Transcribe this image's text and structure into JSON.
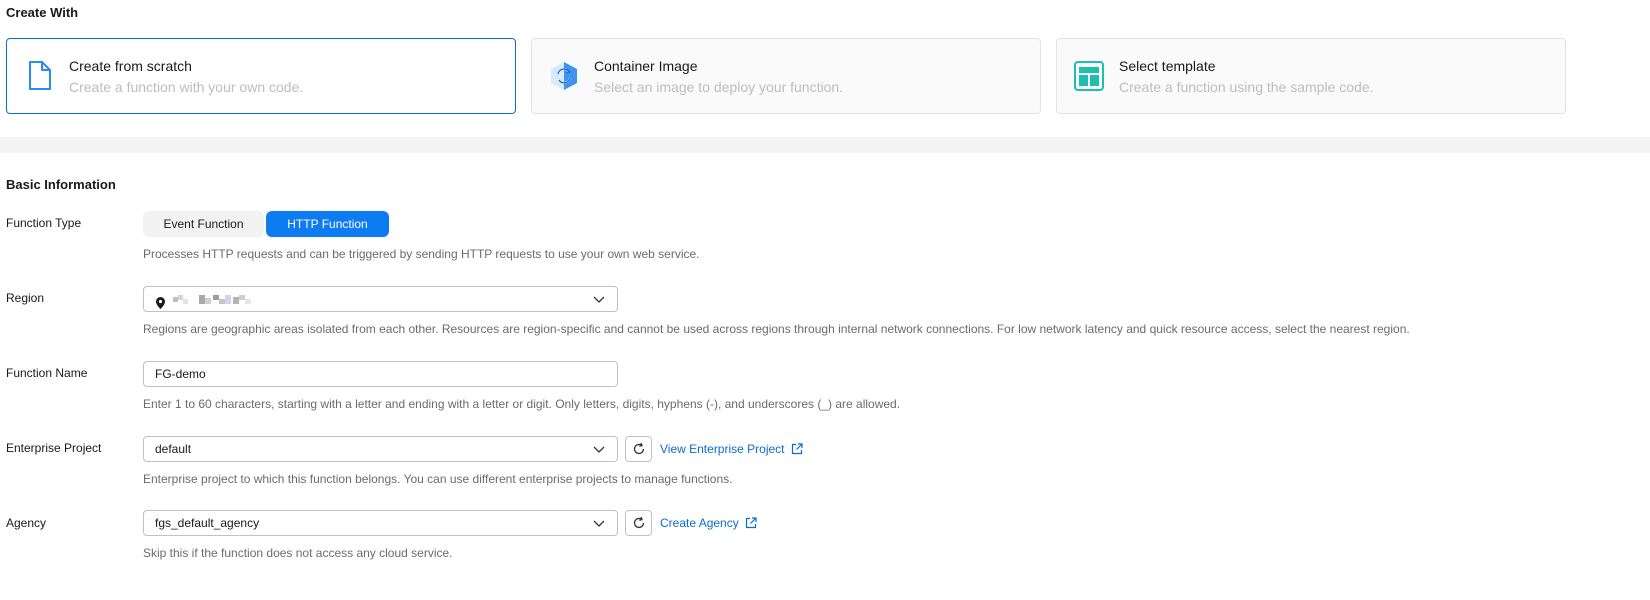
{
  "create_with": {
    "title": "Create With",
    "cards": [
      {
        "title": "Create from scratch",
        "desc": "Create a function with your own code.",
        "icon": "file-icon",
        "selected": true
      },
      {
        "title": "Container Image",
        "desc": "Select an image to deploy your function.",
        "icon": "container-image-icon",
        "selected": false
      },
      {
        "title": "Select template",
        "desc": "Create a function using the sample code.",
        "icon": "template-icon",
        "selected": false
      }
    ]
  },
  "basic": {
    "title": "Basic Information",
    "function_type": {
      "label": "Function Type",
      "options": [
        "Event Function",
        "HTTP Function"
      ],
      "selected": "HTTP Function",
      "help": "Processes HTTP requests and can be triggered by sending HTTP requests to use your own web service."
    },
    "region": {
      "label": "Region",
      "value": "",
      "help": "Regions are geographic areas isolated from each other. Resources are region-specific and cannot be used across regions through internal network connections. For low network latency and quick resource access, select the nearest region."
    },
    "function_name": {
      "label": "Function Name",
      "value": "FG-demo",
      "help": "Enter 1 to 60 characters, starting with a letter and ending with a letter or digit. Only letters, digits, hyphens (-), and underscores (_) are allowed."
    },
    "enterprise_project": {
      "label": "Enterprise Project",
      "value": "default",
      "link": "View Enterprise Project",
      "help": "Enterprise project to which this function belongs. You can use different enterprise projects to manage functions."
    },
    "agency": {
      "label": "Agency",
      "value": "fgs_default_agency",
      "link": "Create Agency",
      "help": "Skip this if the function does not access any cloud service."
    }
  },
  "colors": {
    "accent": "#0d7cf2",
    "link": "#0a6cd6",
    "muted_text": "#6b6b6b"
  }
}
